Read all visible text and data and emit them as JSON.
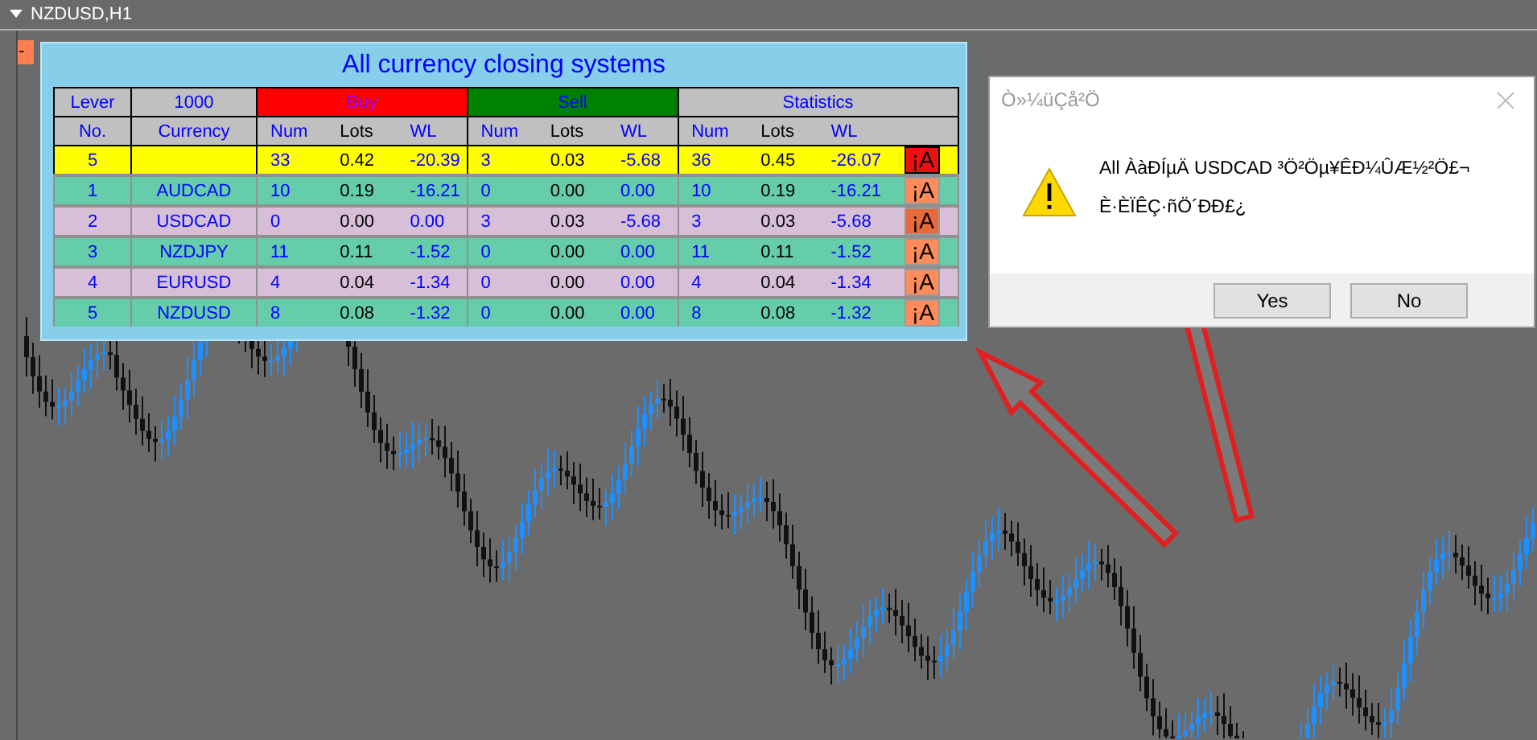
{
  "chart_window": {
    "title": "NZDUSD,H1",
    "collapse_button": "-"
  },
  "panel": {
    "title": "All currency closing systems",
    "lever_label": "Lever",
    "lever_value": "1000",
    "no_label": "No.",
    "currency_label": "Currency",
    "groups": [
      {
        "label": "Buy",
        "color": "#ff0000",
        "sub_columns": [
          "Num",
          "Lots",
          "WL"
        ]
      },
      {
        "label": "Sell",
        "color": "#008000",
        "sub_columns": [
          "Num",
          "Lots",
          "WL"
        ]
      },
      {
        "label": "Statistics",
        "color": "#c0c0c0",
        "sub_columns": [
          "Num",
          "Lots",
          "WL"
        ]
      }
    ],
    "total": {
      "no": "5",
      "buy": [
        "33",
        "0.42",
        "-20.39"
      ],
      "sell": [
        "3",
        "0.03",
        "-5.68"
      ],
      "stats": [
        "36",
        "0.45",
        "-26.07"
      ],
      "button": "¡A"
    },
    "rows": [
      {
        "no": "1",
        "currency": "AUDCAD",
        "color": "#66cdaa",
        "buy": [
          "10",
          "0.19",
          "-16.21"
        ],
        "sell": [
          "0",
          "0.00",
          "0.00"
        ],
        "stats": [
          "10",
          "0.19",
          "-16.21"
        ],
        "button": "¡A",
        "highlighted": false
      },
      {
        "no": "2",
        "currency": "USDCAD",
        "color": "#d8bfd8",
        "buy": [
          "0",
          "0.00",
          "0.00"
        ],
        "sell": [
          "3",
          "0.03",
          "-5.68"
        ],
        "stats": [
          "3",
          "0.03",
          "-5.68"
        ],
        "button": "¡A",
        "highlighted": true
      },
      {
        "no": "3",
        "currency": "NZDJPY",
        "color": "#66cdaa",
        "buy": [
          "11",
          "0.11",
          "-1.52"
        ],
        "sell": [
          "0",
          "0.00",
          "0.00"
        ],
        "stats": [
          "11",
          "0.11",
          "-1.52"
        ],
        "button": "¡A",
        "highlighted": false
      },
      {
        "no": "4",
        "currency": "EURUSD",
        "color": "#d8bfd8",
        "buy": [
          "4",
          "0.04",
          "-1.34"
        ],
        "sell": [
          "0",
          "0.00",
          "0.00"
        ],
        "stats": [
          "4",
          "0.04",
          "-1.34"
        ],
        "button": "¡A",
        "highlighted": false
      },
      {
        "no": "5",
        "currency": "NZDUSD",
        "color": "#66cdaa",
        "buy": [
          "8",
          "0.08",
          "-1.32"
        ],
        "sell": [
          "0",
          "0.00",
          "0.00"
        ],
        "stats": [
          "8",
          "0.08",
          "-1.32"
        ],
        "button": "¡A",
        "highlighted": false
      }
    ]
  },
  "dialog": {
    "title": "Ò»¼üÇå²Ö",
    "message_lines": [
      "All ÀàÐÍµÄ USDCAD ³Ö²Öµ¥ÊÐ¼ÛÆ½²Ö£¬",
      "È·ÈÏÊÇ·ñÖ´ÐÐ£¿"
    ],
    "buttons": [
      "Yes",
      "No"
    ]
  }
}
